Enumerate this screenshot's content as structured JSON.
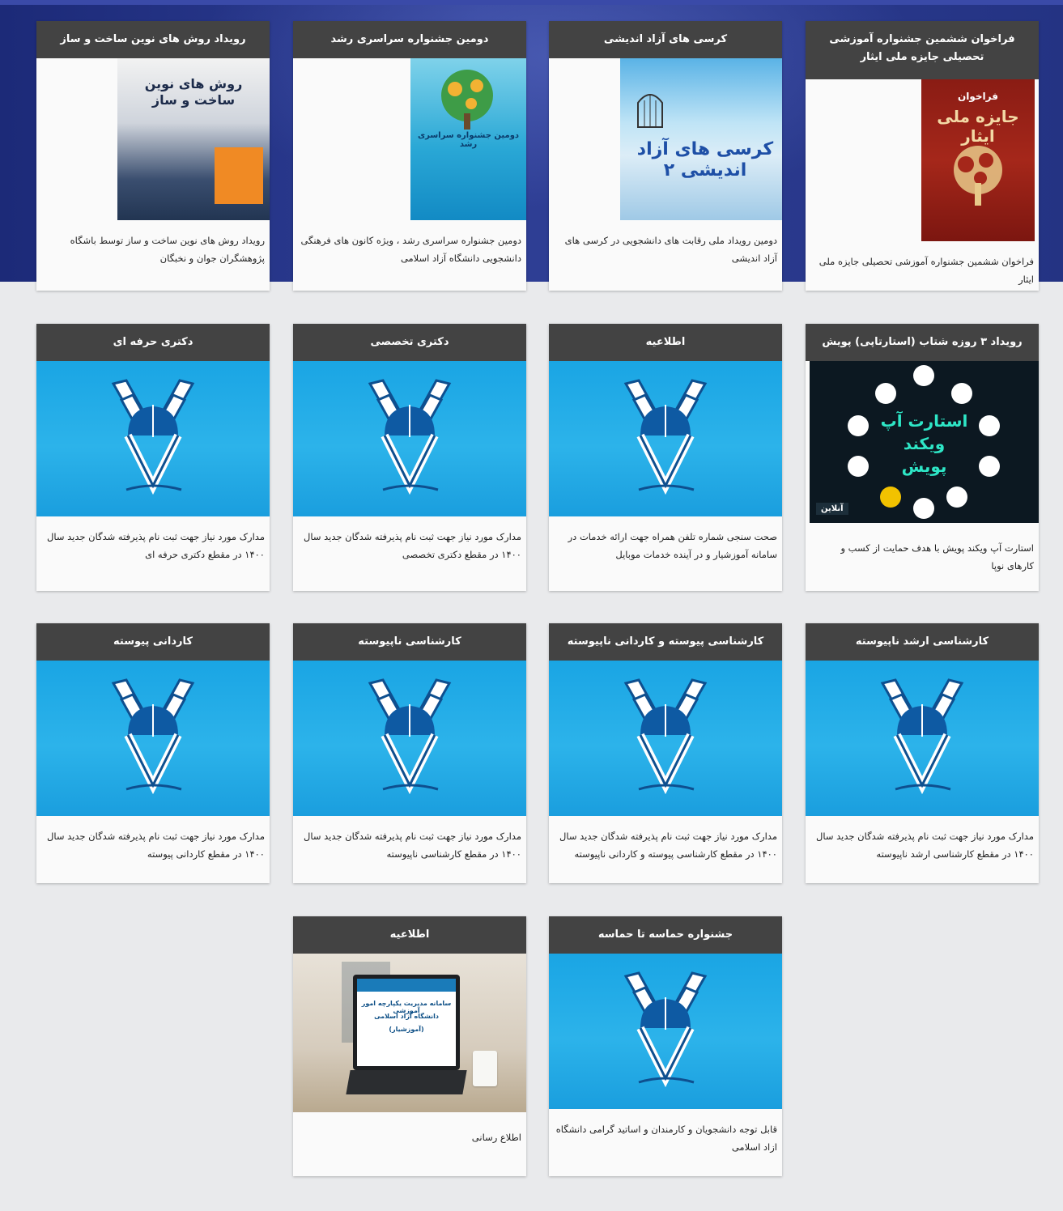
{
  "cards": [
    {
      "title": "فراخوان ششمین جشنواره آموزشی تحصیلی جایزه ملی ایثار",
      "image": "poster-isar",
      "description": "فراخوان ششمین جشنواره آموزشی تحصیلی جایزه ملی ایثار"
    },
    {
      "title": "کرسی های آزاد اندیشی",
      "image": "poster-kursi",
      "description": "دومین رویداد ملی رقابت های دانشجویی در کرسی های آزاد اندیشی"
    },
    {
      "title": "دومین جشنواره سراسری رشد",
      "image": "poster-roshd",
      "description": "دومین جشنواره سراسری رشد ، ویژه کانون های فرهنگی دانشجویی دانشگاه آزاد اسلامی"
    },
    {
      "title": "رویداد روش های نوین ساخت و ساز",
      "image": "poster-sakht",
      "description": "رویداد روش های نوین ساخت و ساز توسط باشگاه پژوهشگران جوان و نخبگان"
    },
    {
      "title": "رویداد ۳ روزه شتاب (استارتاپی) پویش",
      "image": "startup-weekend",
      "description": "استارت آپ ویکند پویش با هدف حمایت از کسب و کارهای نوپا"
    },
    {
      "title": "اطلاعیه",
      "image": "iau-logo",
      "description": "صحت سنجی شماره تلفن همراه جهت ارائه خدمات در سامانه آموزشیار و در آینده خدمات موبایل"
    },
    {
      "title": "دکتری تخصصی",
      "image": "iau-logo",
      "description": "مدارک مورد نیاز جهت ثبت نام پذیرفته شدگان جدید سال ۱۴۰۰ در مقطع دکتری تخصصی"
    },
    {
      "title": "دکتری حرفه ای",
      "image": "iau-logo",
      "description": "مدارک مورد نیاز جهت ثبت نام پذیرفته شدگان جدید سال ۱۴۰۰ در مقطع دکتری حرفه ای"
    },
    {
      "title": "کارشناسی ارشد ناپیوسته",
      "image": "iau-logo",
      "description": "مدارک مورد نیاز جهت ثبت نام پذیرفته شدگان جدید سال ۱۴۰۰ در مقطع کارشناسی ارشد ناپیوسته"
    },
    {
      "title": "کارشناسی پیوسته و کاردانی ناپیوسته",
      "image": "iau-logo",
      "description": "مدارک مورد نیاز جهت ثبت نام پذیرفته شدگان جدید سال ۱۴۰۰ در مقطع کارشناسی پیوسته و کاردانی ناپیوسته"
    },
    {
      "title": "کارشناسی ناپیوسته",
      "image": "iau-logo",
      "description": "مدارک مورد نیاز جهت ثبت نام پذیرفته شدگان جدید سال ۱۴۰۰ در مقطع کارشناسی ناپیوسته"
    },
    {
      "title": "کاردانی پیوسته",
      "image": "iau-logo",
      "description": "مدارک مورد نیاز جهت ثبت نام پذیرفته شدگان جدید سال ۱۴۰۰ در مقطع کاردانی پیوسته"
    },
    {
      "title": "جشنواره حماسه تا حماسه",
      "image": "iau-logo",
      "description": "قابل توجه دانشجویان و کارمندان و اساتید گرامی دانشگاه ازاد اسلامی"
    },
    {
      "title": "اطلاعیه",
      "image": "laptop-amoozeshyar",
      "description": "اطلاع رسانی"
    }
  ],
  "poster_texts": {
    "isar_line1": "فراخوان",
    "isar_line2": "جایزه ملی ایثار",
    "kursi": "کرسی های آزاد اندیشی ۲",
    "roshd": "دومین جشنواره سراسری رشد",
    "sakht_line1": "روش های نوین",
    "sakht_line2": "ساخت و ساز",
    "startup_line1": "استارت آپ",
    "startup_line2": "ویکند",
    "startup_line3": "پویش",
    "startup_badge": "آنلاین",
    "laptop_line1": "سامانه مدیریت یکپارچه امور آموزشی",
    "laptop_line2": "دانشگاه آزاد اسلامی",
    "laptop_line3": "(آموزشیار)"
  },
  "colors": {
    "card_header": "#434343",
    "page_bg": "#e9eaec",
    "hero_bg": "#2a3a8e",
    "iau_blue": "#1aa5e4"
  }
}
